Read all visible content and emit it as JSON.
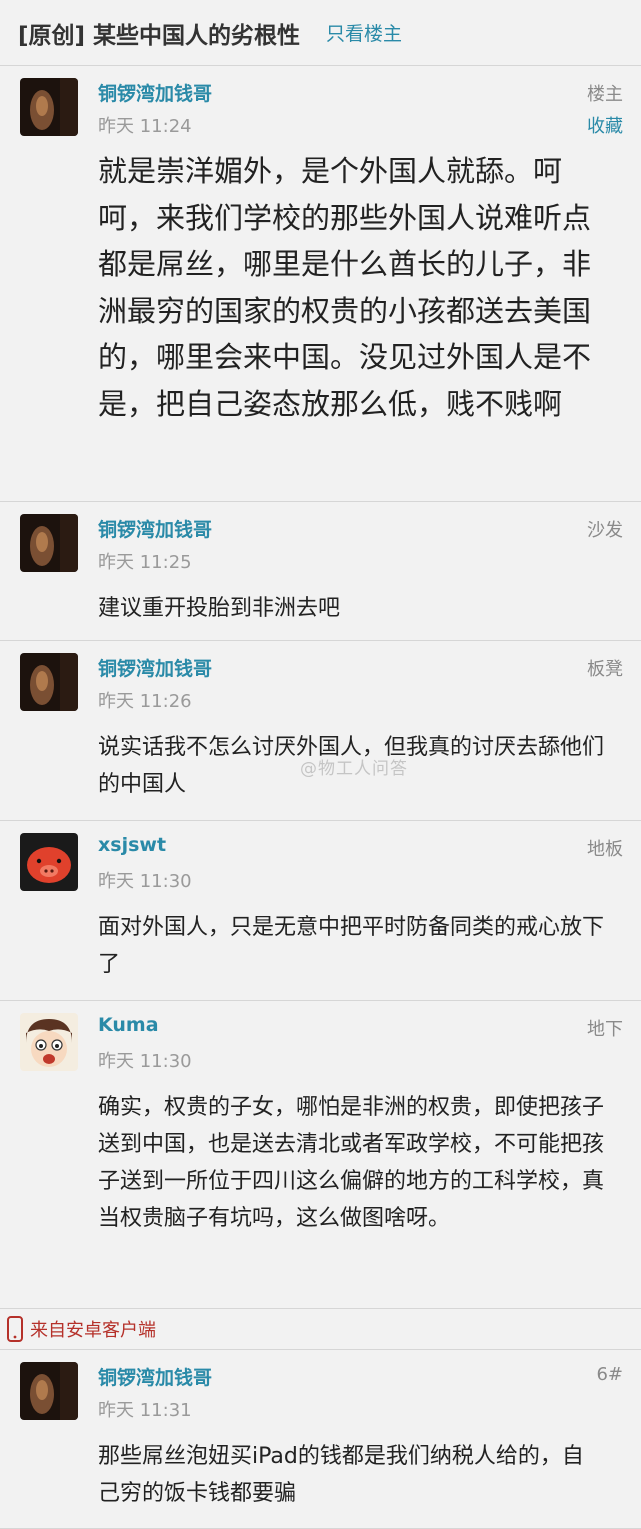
{
  "header": {
    "title": "[原创] 某些中国人的劣根性",
    "only_op": "只看楼主"
  },
  "posts": [
    {
      "username": "铜锣湾加钱哥",
      "time": "昨天 11:24",
      "floor": "楼主",
      "favorite": "收藏",
      "content": "就是崇洋媚外，是个外国人就舔。呵呵，来我们学校的那些外国人说难听点都是屌丝，哪里是什么酋长的儿子，非洲最穷的国家的权贵的小孩都送去美国的，哪里会来中国。没见过外国人是不是，把自己姿态放那么低，贱不贱啊",
      "avatar": "dark-portrait"
    },
    {
      "username": "铜锣湾加钱哥",
      "time": "昨天 11:25",
      "floor": "沙发",
      "content": "建议重开投胎到非洲去吧",
      "avatar": "dark-portrait"
    },
    {
      "username": "铜锣湾加钱哥",
      "time": "昨天 11:26",
      "floor": "板凳",
      "content": "说实话我不怎么讨厌外国人，但我真的讨厌去舔他们的中国人",
      "avatar": "dark-portrait"
    },
    {
      "username": "xsjswt",
      "time": "昨天 11:30",
      "floor": "地板",
      "content": "面对外国人，只是无意中把平时防备同类的戒心放下了",
      "avatar": "red-pig"
    },
    {
      "username": "Kuma",
      "time": "昨天 11:30",
      "floor": "地下",
      "content": "确实，权贵的子女，哪怕是非洲的权贵，即使把孩子送到中国，也是送去清北或者军政学校，不可能把孩子送到一所位于四川这么偏僻的地方的工科学校，真当权贵脑子有坑吗，这么做图啥呀。",
      "avatar": "anime-face"
    },
    {
      "username": "铜锣湾加钱哥",
      "time": "昨天 11:31",
      "floor": "6#",
      "content": "那些屌丝泡妞买iPad的钱都是我们纳税人给的，自己穷的饭卡钱都要骗",
      "avatar": "dark-portrait"
    }
  ],
  "client_label": "来自安卓客户端",
  "watermark": "@物工人问答",
  "colors": {
    "link": "#2a8aa8",
    "background": "#f2f2f2",
    "client_label": "#b5312a"
  }
}
